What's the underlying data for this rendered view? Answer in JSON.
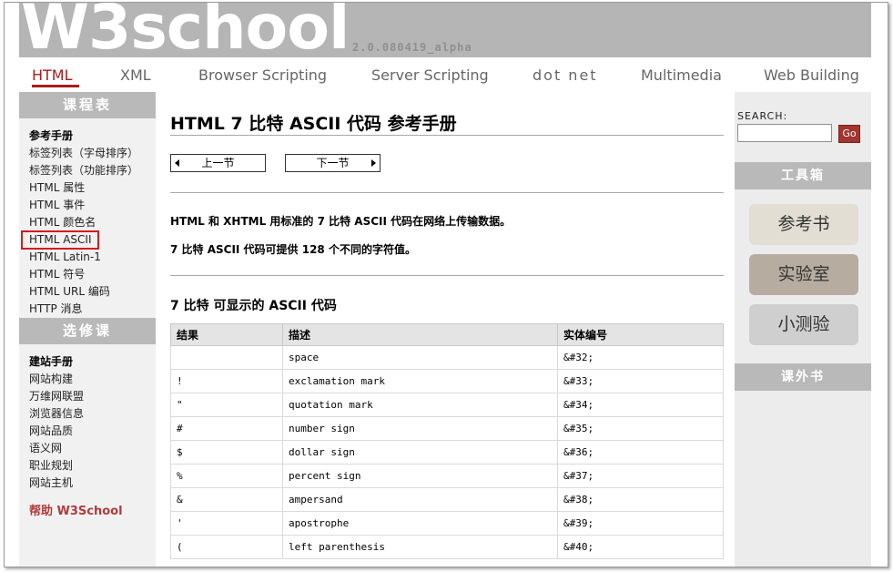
{
  "header": {
    "logo": "W3school",
    "version": "2.0.080419_alpha"
  },
  "topnav": [
    "HTML",
    "XML",
    "Browser Scripting",
    "Server Scripting",
    "dot net",
    "Multimedia",
    "Web Building"
  ],
  "left": {
    "head1": "课程表",
    "items1": [
      "参考手册",
      "标签列表（字母排序）",
      "标签列表（功能排序）",
      "HTML 属性",
      "HTML 事件",
      "HTML 颜色名",
      "HTML ASCII",
      "HTML Latin-1",
      "HTML 符号",
      "HTML URL 编码",
      "HTTP 消息"
    ],
    "head2": "选修课",
    "items2": [
      "建站手册",
      "网站构建",
      "万维网联盟",
      "浏览器信息",
      "网站品质",
      "语义网",
      "职业规划",
      "网站主机"
    ],
    "help": "帮助 W3School"
  },
  "main": {
    "title": "HTML 7 比特 ASCII 代码 参考手册",
    "prev": "上一节",
    "next": "下一节",
    "p1": "HTML 和 XHTML 用标准的 7 比特 ASCII 代码在网络上传输数据。",
    "p2": "7 比特 ASCII 代码可提供 128 个不同的字符值。",
    "section": "7 比特 可显示的 ASCII 代码",
    "table_headers": [
      "结果",
      "描述",
      "实体编号"
    ],
    "rows": [
      [
        "",
        "space",
        "&#32;"
      ],
      [
        "!",
        "exclamation mark",
        "&#33;"
      ],
      [
        "\"",
        "quotation mark",
        "&#34;"
      ],
      [
        "#",
        "number sign",
        "&#35;"
      ],
      [
        "$",
        "dollar sign",
        "&#36;"
      ],
      [
        "%",
        "percent sign",
        "&#37;"
      ],
      [
        "&",
        "ampersand",
        "&#38;"
      ],
      [
        "'",
        "apostrophe",
        "&#39;"
      ],
      [
        "(",
        "left parenthesis",
        "&#40;"
      ]
    ]
  },
  "right": {
    "search_label": "SEARCH:",
    "go": "Go",
    "toolbox": "工具箱",
    "tools": [
      "参考书",
      "实验室",
      "小测验"
    ],
    "books": "课外书"
  }
}
